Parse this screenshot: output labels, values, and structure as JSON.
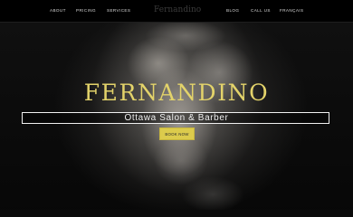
{
  "nav": {
    "left": [
      "ABOUT",
      "PRICING",
      "SERVICES"
    ],
    "right": [
      "BLOG",
      "CALL US",
      "FRANÇAIS"
    ],
    "logo_text": "Fernandino"
  },
  "hero": {
    "title": "FERNANDINO",
    "tagline": "Ottawa Salon & Barber",
    "cta_label": "BOOK NOW"
  },
  "colors": {
    "accent": "#dccb4c",
    "title_gold": "#e3d36a",
    "background": "#000000",
    "nav_text": "#d8d8d8"
  }
}
